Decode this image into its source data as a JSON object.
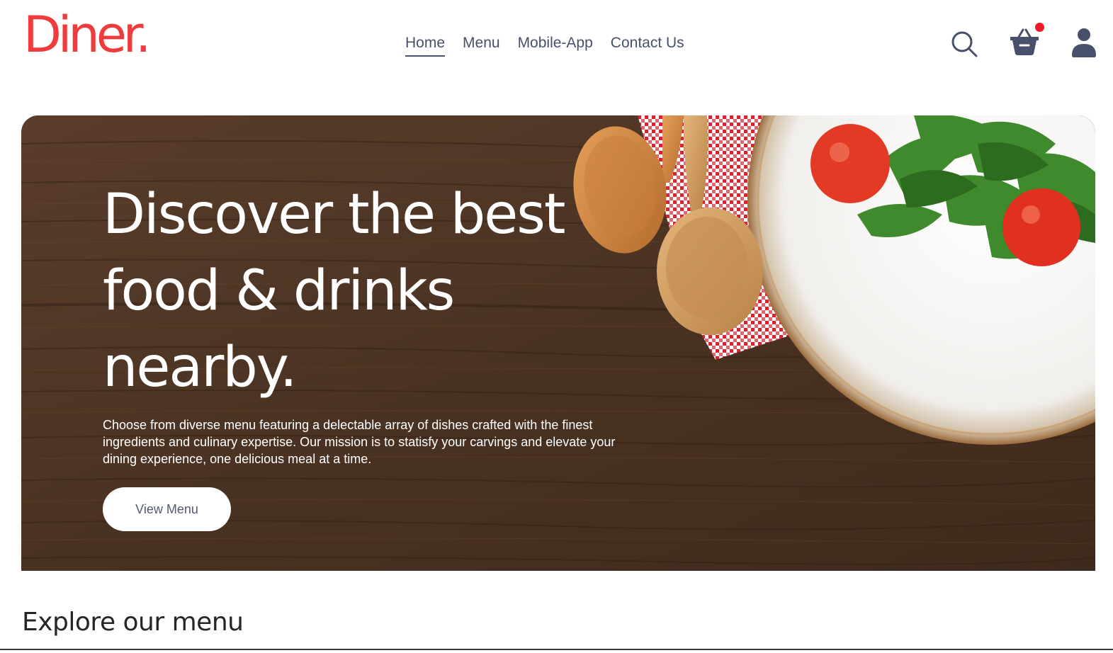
{
  "brand": {
    "name": "Diner."
  },
  "nav": {
    "items": [
      {
        "label": "Home",
        "active": true
      },
      {
        "label": "Menu",
        "active": false
      },
      {
        "label": "Mobile-App",
        "active": false
      },
      {
        "label": "Contact Us",
        "active": false
      }
    ]
  },
  "header_icons": {
    "search": "search-icon",
    "basket": "basket-icon",
    "basket_has_notification": true,
    "profile": "profile-icon"
  },
  "hero": {
    "title": "Discover the best food & drinks nearby.",
    "description": "Choose from diverse menu featuring a delectable array of dishes crafted with the finest ingredients and culinary expertise. Our mission is to statisfy your carvings and elevate your dining experience, one delicious meal at a time.",
    "button_label": "View Menu"
  },
  "explore": {
    "title": "Explore our menu"
  },
  "colors": {
    "brand": "#ef3b3b",
    "nav_text": "#48516b",
    "notification": "#ee1c25",
    "hero_wood": "#4d3424"
  }
}
